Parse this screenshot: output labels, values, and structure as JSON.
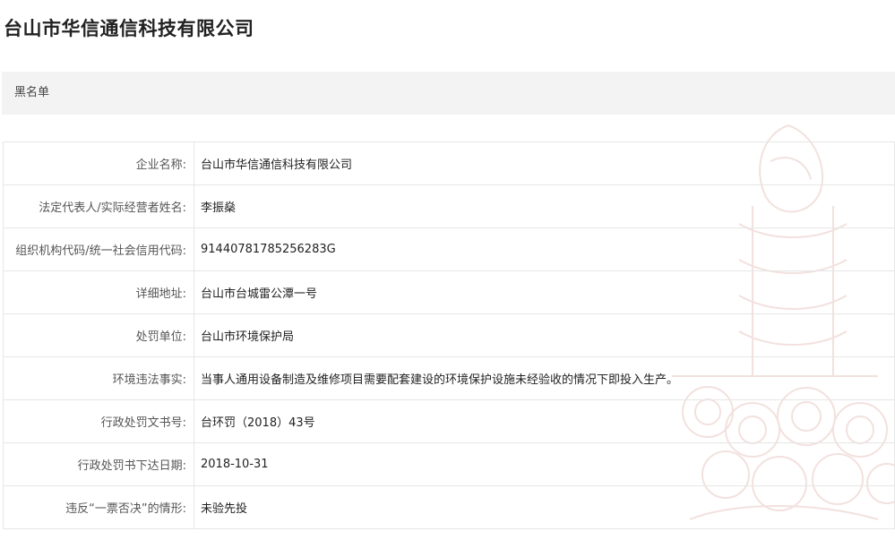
{
  "page": {
    "title": "台山市华信通信科技有限公司",
    "section_label": "黑名单"
  },
  "colors": {
    "section_background": "#f3f3f3",
    "border": "#e6e6e6",
    "watermark": "#e9c9c4"
  },
  "icons": {
    "watermark": "emblem-watermark-icon"
  },
  "record": {
    "rows": [
      {
        "label": "企业名称:",
        "value": "台山市华信通信科技有限公司"
      },
      {
        "label": "法定代表人/实际经营者姓名:",
        "value": "李振燊"
      },
      {
        "label": "组织机构代码/统一社会信用代码:",
        "value": "91440781785256283G"
      },
      {
        "label": "详细地址:",
        "value": "台山市台城雷公潭一号"
      },
      {
        "label": "处罚单位:",
        "value": "台山市环境保护局"
      },
      {
        "label": "环境违法事实:",
        "value": "当事人通用设备制造及维修项目需要配套建设的环境保护设施未经验收的情况下即投入生产。"
      },
      {
        "label": "行政处罚文书号:",
        "value": "台环罚（2018）43号"
      },
      {
        "label": "行政处罚书下达日期:",
        "value": "2018-10-31"
      },
      {
        "label": "违反“一票否决”的情形:",
        "value": "未验先投"
      }
    ]
  }
}
